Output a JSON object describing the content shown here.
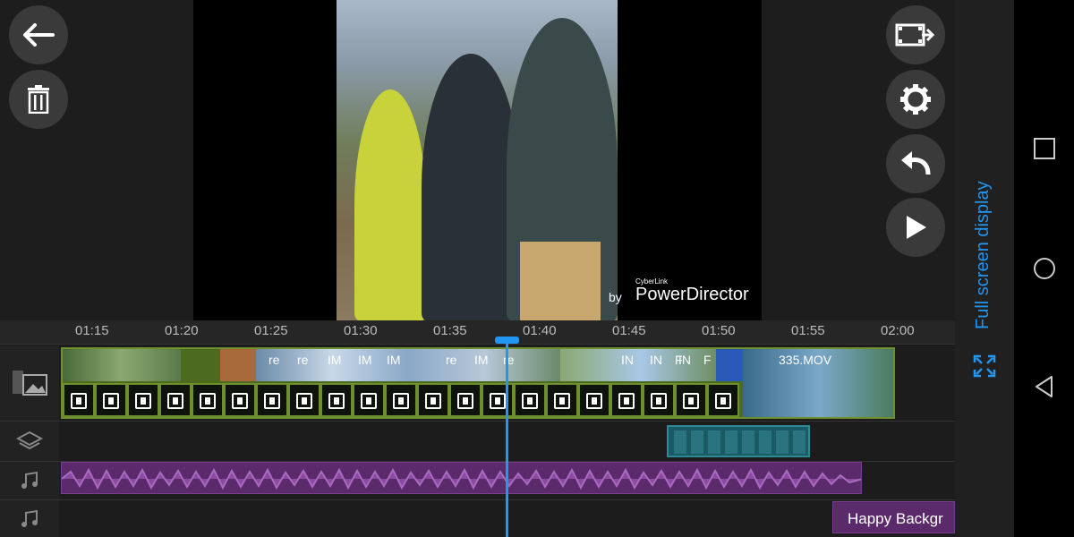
{
  "toolbar_left": {
    "back_icon": "arrow-left-icon",
    "delete_icon": "trash-icon"
  },
  "toolbar_right": {
    "export_icon": "film-export-icon",
    "settings_icon": "gear-icon",
    "undo_icon": "undo-icon",
    "play_icon": "play-icon"
  },
  "watermark": {
    "by": "by",
    "small": "CyberLink",
    "brand": "PowerDirector"
  },
  "side_panel": {
    "fullscreen_label": "Full screen display",
    "fullscreen_icon": "expand-icon"
  },
  "timeline": {
    "ruler_ticks": [
      "01:15",
      "01:20",
      "01:25",
      "01:30",
      "01:35",
      "01:40",
      "01:45",
      "01:50",
      "01:55",
      "02:00"
    ],
    "clip_labels": [
      "re",
      "re",
      "IM",
      "IM",
      "IM",
      "re",
      "IM",
      "re",
      "IN",
      "IN",
      "IN",
      "F",
      "F"
    ],
    "last_clip_name": "335.MOV",
    "music_track_2_name": "Happy Backgr",
    "track_icons": [
      "video-track-icon",
      "layers-icon",
      "music-note-icon",
      "music-note-icon"
    ]
  },
  "colors": {
    "accent": "#2196f3",
    "video_clip": "#6f8f2e",
    "overlay_clip": "#2c8a96",
    "music_clip": "#7b3d8d"
  },
  "nav_bar": {
    "recents_icon": "square-icon",
    "home_icon": "circle-icon",
    "back_icon": "triangle-back-icon"
  }
}
